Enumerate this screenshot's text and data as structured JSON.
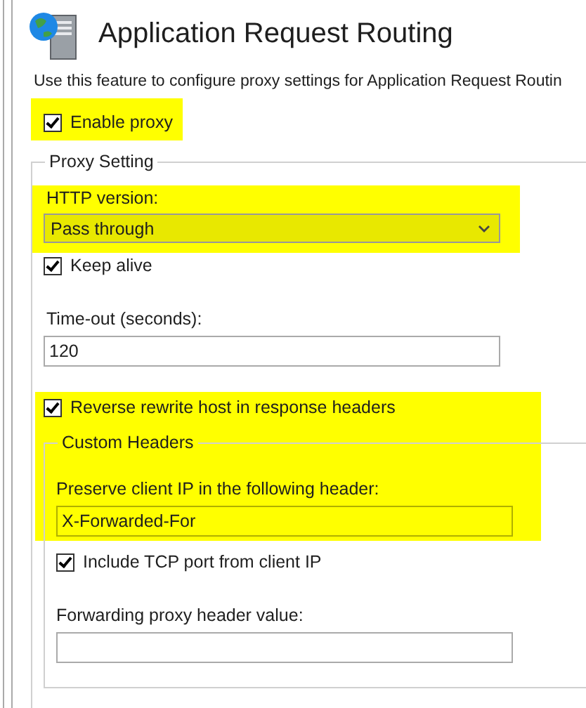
{
  "header": {
    "title": "Application Request Routing",
    "description": "Use this feature to configure proxy settings for Application Request Routin"
  },
  "enable_proxy": {
    "label": "Enable proxy",
    "checked": true,
    "highlighted": true
  },
  "proxy_setting": {
    "title": "Proxy Setting",
    "http_version": {
      "label": "HTTP version:",
      "value": "Pass through",
      "highlighted": true
    },
    "keep_alive": {
      "label": "Keep alive",
      "checked": true
    },
    "timeout": {
      "label": "Time-out (seconds):",
      "value": "120"
    },
    "reverse_rewrite": {
      "label": "Reverse rewrite host in response headers",
      "checked": true,
      "highlighted": true
    },
    "custom_headers": {
      "title": "Custom Headers",
      "preserve_client_ip": {
        "label": "Preserve client IP in the following header:",
        "value": "X-Forwarded-For"
      },
      "include_tcp_port": {
        "label": "Include TCP port from client IP",
        "checked": true
      },
      "forwarding_proxy_header": {
        "label": "Forwarding proxy header value:"
      }
    }
  }
}
